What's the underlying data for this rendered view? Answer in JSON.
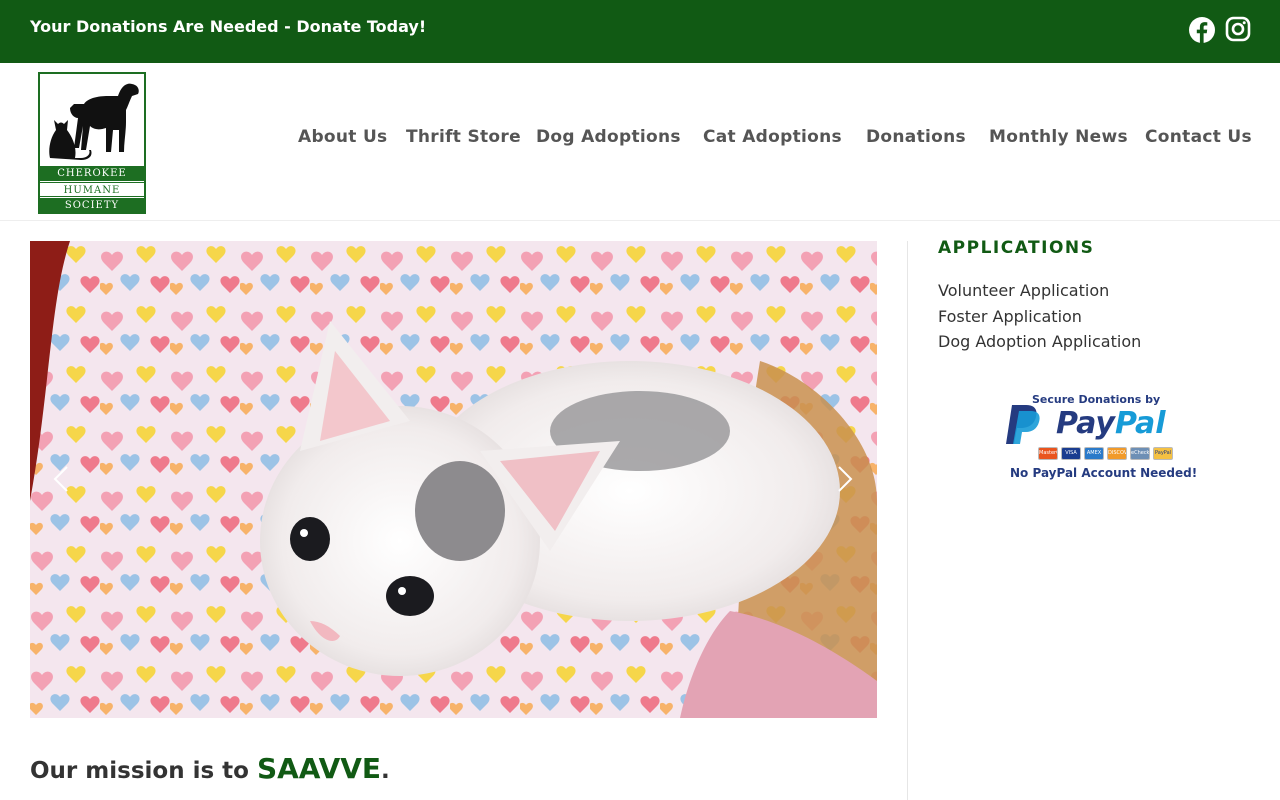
{
  "topbar": {
    "announcement": "Your Donations Are Needed - Donate Today!",
    "social": [
      {
        "name": "facebook-icon"
      },
      {
        "name": "instagram-icon"
      }
    ]
  },
  "logo": {
    "line1": "CHEROKEE",
    "line2": "HUMANE",
    "line3": "SOCIETY"
  },
  "nav": {
    "items": [
      {
        "label": "About Us"
      },
      {
        "label": "Thrift Store"
      },
      {
        "label": "Dog Adoptions"
      },
      {
        "label": "Cat Adoptions"
      },
      {
        "label": "Donations"
      },
      {
        "label": "Monthly News"
      },
      {
        "label": "Contact Us"
      }
    ]
  },
  "slider": {
    "prev_icon": "chevron-left-icon",
    "next_icon": "chevron-right-icon"
  },
  "mission": {
    "lead": "Our mission is to ",
    "keyword": "SAAVVE",
    "end": "."
  },
  "sidebar": {
    "title": "APPLICATIONS",
    "links": [
      {
        "label": "Volunteer Application"
      },
      {
        "label": "Foster Application"
      },
      {
        "label": "Dog Adoption Application"
      }
    ]
  },
  "paypal": {
    "secure": "Secure Donations by",
    "pay": "Pay",
    "pal": "Pal",
    "no_account": "No PayPal Account Needed!",
    "cards": [
      "MasterCard",
      "VISA",
      "AMEX",
      "DISCOVER",
      "eCheck",
      "PayPal"
    ]
  },
  "colors": {
    "brand_green": "#115a14",
    "paypal_dark": "#253b80",
    "paypal_light": "#179bd7"
  }
}
